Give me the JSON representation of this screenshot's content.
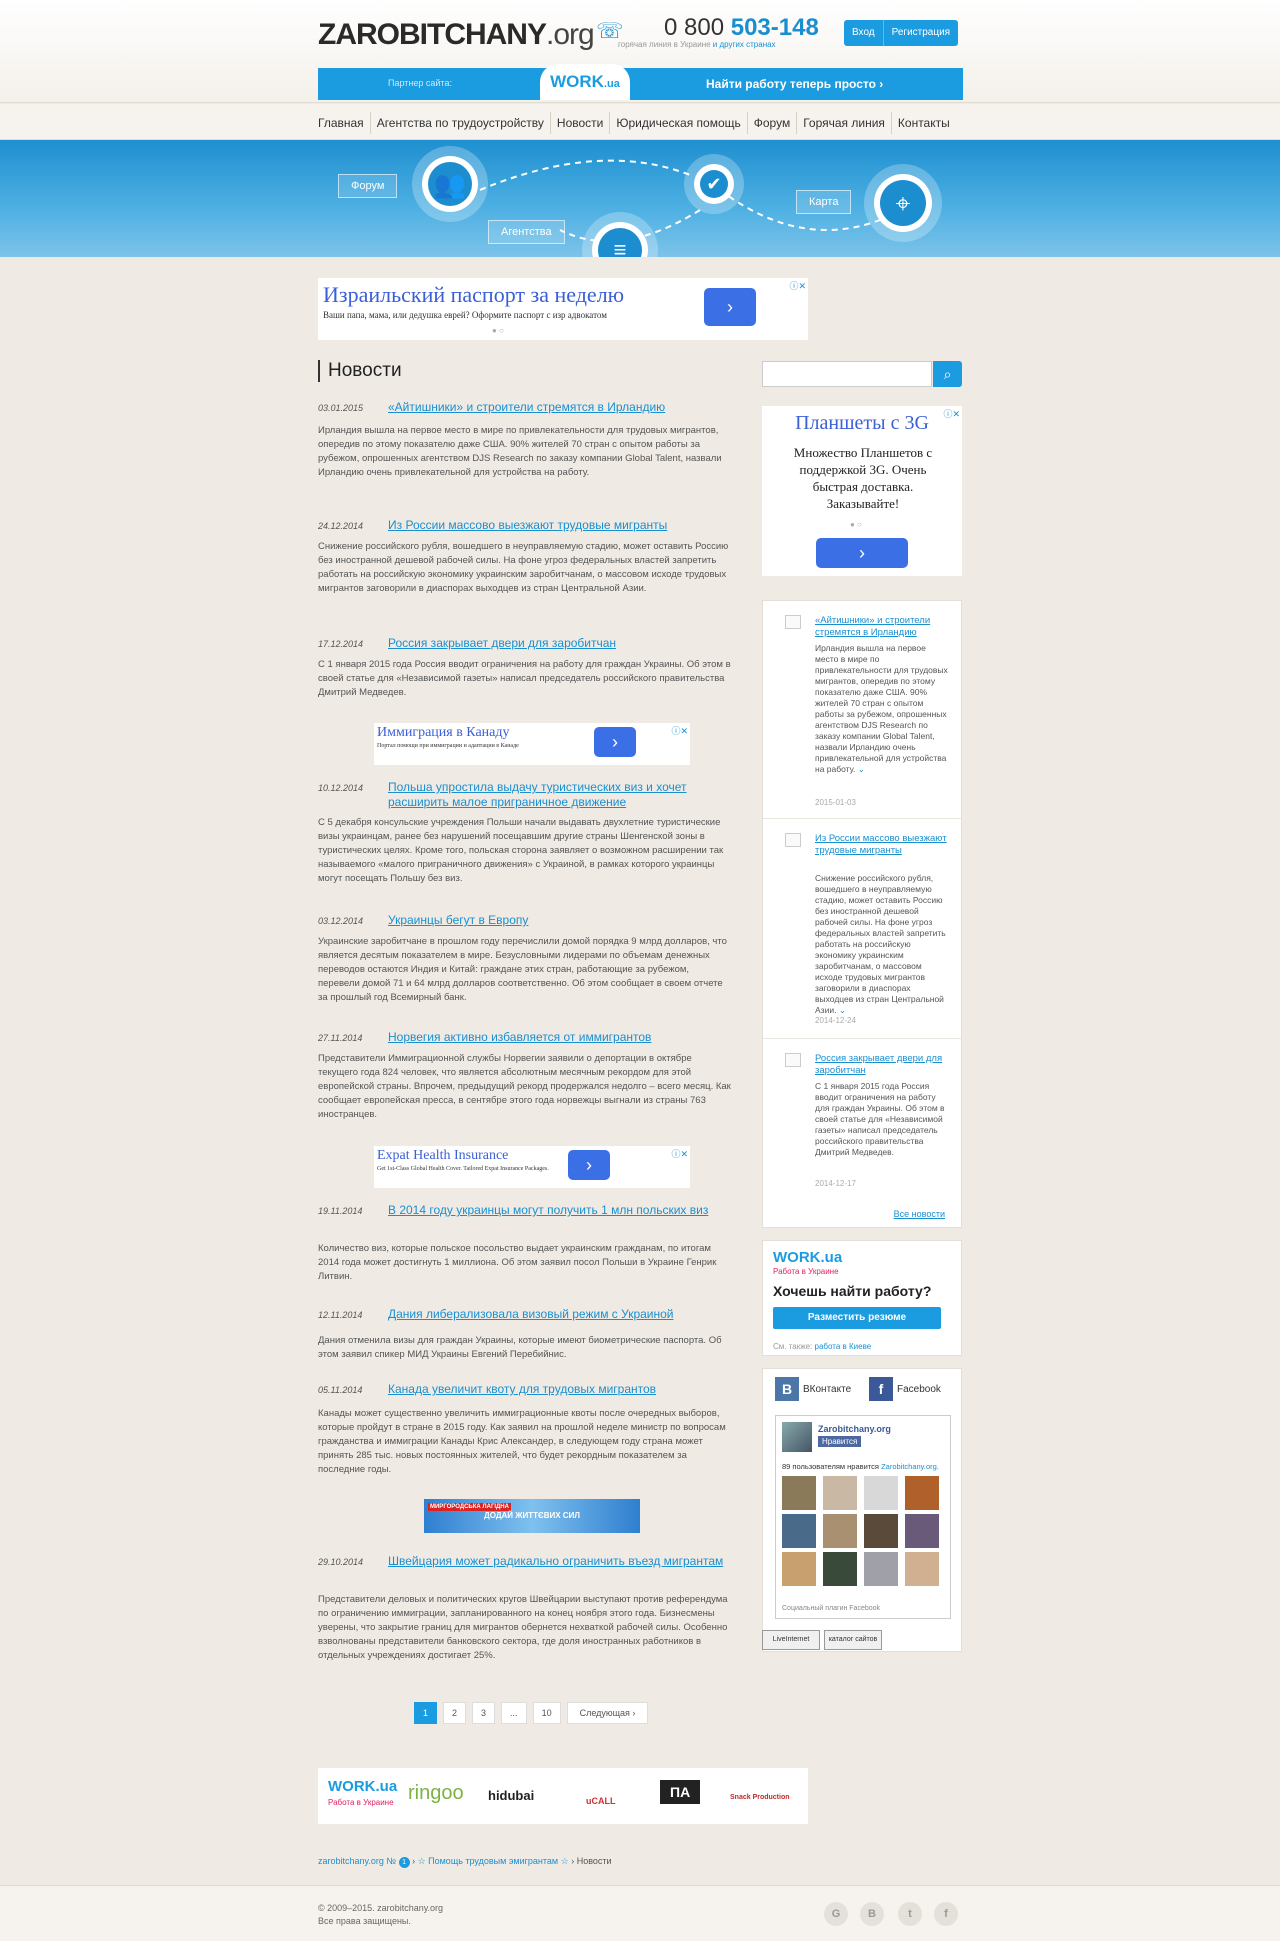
{
  "header": {
    "logo_main": "ZAROBITCHANY",
    "logo_tld": ".org",
    "phone_prefix": "0 800",
    "phone_number": "503-148",
    "phone_sub": "горячая линия в Украине",
    "phone_sub_link": "и других странах",
    "login": "Вход",
    "register": "Регистрация"
  },
  "partner": {
    "label": "Партнер сайта:",
    "logo": "WORK",
    "logo_tld": ".ua",
    "cta": "Найти работу теперь просто ›"
  },
  "nav": [
    "Главная",
    "Агентства по трудоустройству",
    "Новости",
    "Юридическая помощь",
    "Форум",
    "Горячая линия",
    "Контакты"
  ],
  "banner": {
    "forum": "Форум",
    "agencies": "Агентства",
    "map": "Карта"
  },
  "ad_top": {
    "title": "Израильский паспорт за неделю",
    "subtitle": "Ваши папа, мама, или дедушка еврей? Оформите паспорт с изр адвокатом"
  },
  "news_heading": "Новости",
  "news": [
    {
      "date": "03.01.2015",
      "title": "«Айтишники» и строители стремятся в Ирландию",
      "body": "Ирландия вышла на первое место в мире по привлекательности для трудовых мигрантов, опередив по этому показателю даже США. 90% жителей 70 стран с опытом работы за рубежом, опрошенных агентством DJS Research по заказу компании Global Talent, назвали Ирландию очень привлекательной для устройства на работу."
    },
    {
      "date": "24.12.2014",
      "title": "Из России массово выезжают трудовые мигранты",
      "body": "Снижение российского рубля, вошедшего в неуправляемую стадию, может оставить Россию без иностранной дешевой рабочей силы. На фоне угроз федеральных властей запретить работать на российскую экономику украинским заробитчанам, о массовом исходе трудовых мигрантов заговорили в диаспорах выходцев из стран Центральной Азии."
    },
    {
      "date": "17.12.2014",
      "title": "Россия закрывает двери для заробитчан",
      "body": "С 1 января 2015 года Россия вводит ограничения на работу для граждан Украины. Об этом в своей статье для «Независимой газеты» написал председатель российского правительства Дмитрий Медведев."
    },
    {
      "date": "10.12.2014",
      "title": "Польша упростила выдачу туристических виз и хочет расширить малое приграничное движение",
      "body": "С 5 декабря консульские учреждения Польши начали выдавать двухлетние туристические визы украинцам, ранее без нарушений посещавшим другие страны Шенгенской зоны в туристических целях. Кроме того, польская сторона заявляет о возможном расширении так называемого «малого приграничного движения» с Украиной, в рамках которого украинцы могут посещать Польшу без виз."
    },
    {
      "date": "03.12.2014",
      "title": "Украинцы бегут в Европу",
      "body": "Украинские заробитчане в прошлом году перечислили домой порядка 9 млрд долларов, что является десятым показателем в мире. Безусловными лидерами по объемам денежных переводов остаются Индия и Китай: граждане этих стран, работающие за рубежом, перевели домой 71 и 64 млрд долларов соответственно. Об этом сообщает в своем отчете за прошлый год Всемирный банк."
    },
    {
      "date": "27.11.2014",
      "title": "Норвегия активно избавляется от иммигрантов",
      "body": "Представители Иммиграционной службы Норвегии заявили о депортации в октябре текущего года 824 человек, что является абсолютным месячным рекордом для этой европейской страны. Впрочем, предыдущий рекорд продержался недолго – всего месяц. Как сообщает европейская пресса, в сентябре этого года норвежцы выгнали из страны 763 иностранцев."
    },
    {
      "date": "19.11.2014",
      "title": "В 2014 году украинцы могут получить 1 млн польских виз",
      "body": "Количество виз, которые польское посольство выдает украинским гражданам, по итогам 2014 года может достигнуть 1 миллиона. Об этом заявил посол Польши в Украине Генрик Литвин."
    },
    {
      "date": "12.11.2014",
      "title": "Дания либерализовала визовый режим с Украиной",
      "body": "Дания отменила визы для граждан Украины, которые имеют биометрические паспорта. Об этом заявил спикер МИД Украины Евгений Перебийнис."
    },
    {
      "date": "05.11.2014",
      "title": "Канада увеличит квоту для трудовых мигрантов",
      "body": "Канады может существенно увеличить иммиграционные квоты после очередных выборов, которые пройдут в стране в 2015 году. Как заявил на прошлой неделе министр по вопросам гражданства и иммиграции Канады Крис Александер, в следующем году страна может принять 285 тыс. новых постоянных жителей, что будет рекордным показателем за последние годы."
    },
    {
      "date": "29.10.2014",
      "title": "Швейцария может радикально ограничить въезд мигрантам",
      "body": "Представители деловых и политических кругов Швейцарии выступают против референдума по ограничению иммиграции, запланированного на конец ноября этого года. Бизнесмены уверены, что закрытие границ для мигрантов обернется нехваткой рабочей силы. Особенно взволнованы представители банковского сектора, где доля иностранных работников в отдельных учреждениях достигает 25%."
    }
  ],
  "ads_inline": [
    {
      "title": "Иммиграция в Канаду",
      "subtitle": "Портал помощи при иммиграции и адаптации в Канаде"
    },
    {
      "title": "Expat Health Insurance",
      "subtitle": "Get 1st-Class Global Health Cover. Tailored Expat Insurance Packages."
    },
    {
      "title": "ДОДАЙ ЖИТТЄВИХ СИЛ",
      "subtitle": "МИРГОРОДСЬКА ЛАГІДНА"
    }
  ],
  "pagination": [
    "1",
    "2",
    "3",
    "...",
    "10",
    "Следующая ›"
  ],
  "partners": [
    "WORK.ua",
    "ringoo",
    "hidubai",
    "uCALL",
    "ПА",
    "Snack Production"
  ],
  "partners_work_sub": "Работа в Украине",
  "breadcrumbs": {
    "home": "zarobitchany.org №",
    "section": "☆ Помощь трудовым эмигрантам ☆",
    "current": "Новости",
    "sep": "›"
  },
  "footer": {
    "copyright": "© 2009–2015. zarobitchany.org",
    "rights": "Все права защищены.",
    "social": [
      "G",
      "B",
      "t",
      "f"
    ]
  },
  "ad_side": {
    "title": "Планшеты с 3G",
    "subtitle": "Множество Планшетов с поддержкой 3G. Очень быстрая доставка. Заказывайте!"
  },
  "side_news": [
    {
      "title": "«Айтишники» и строители стремятся в Ирландию",
      "body": "Ирландия вышла на первое место в мире по привлекательности для трудовых мигрантов, опередив по этому показателю даже США. 90% жителей 70 стран с опытом работы за рубежом, опрошенных агентством DJS Research по заказу компании Global Talent, назвали Ирландию очень привлекательной для устройства на работу.",
      "date": "2015-01-03"
    },
    {
      "title": "Из России массово выезжают трудовые мигранты",
      "body": "Снижение российского рубля, вошедшего в неуправляемую стадию, может оставить Россию без иностранной дешевой рабочей силы. На фоне угроз федеральных властей запретить работать на российскую экономику украинским заробитчанам, о массовом исходе трудовых мигрантов заговорили в диаспорах выходцев из стран Центральной Азии.",
      "date": "2014-12-24"
    },
    {
      "title": "Россия закрывает двери для заробитчан",
      "body": "С 1 января 2015 года Россия вводит ограничения на работу для граждан Украины. Об этом в своей статье для «Независимой газеты» написал председатель российского правительства Дмитрий Медведев.",
      "date": "2014-12-17"
    }
  ],
  "side_all": "Все новости",
  "work": {
    "logo": "WORK.ua",
    "sub": "Работа в Украине",
    "question": "Хочешь найти работу?",
    "button": "Разместить резюме",
    "see_also": "См. также:",
    "see_also_link": "работа в Киеве"
  },
  "social": {
    "vk": "ВКонтакте",
    "fb": "Facebook",
    "page_name": "Zarobitchany.org",
    "like": "Нравится",
    "count": "89 пользователям нравится",
    "count_link": "Zarobitchany.org.",
    "plugin": "Социальный плагин Facebook"
  },
  "counters": [
    "LiveInternet",
    "каталог сайтов"
  ]
}
